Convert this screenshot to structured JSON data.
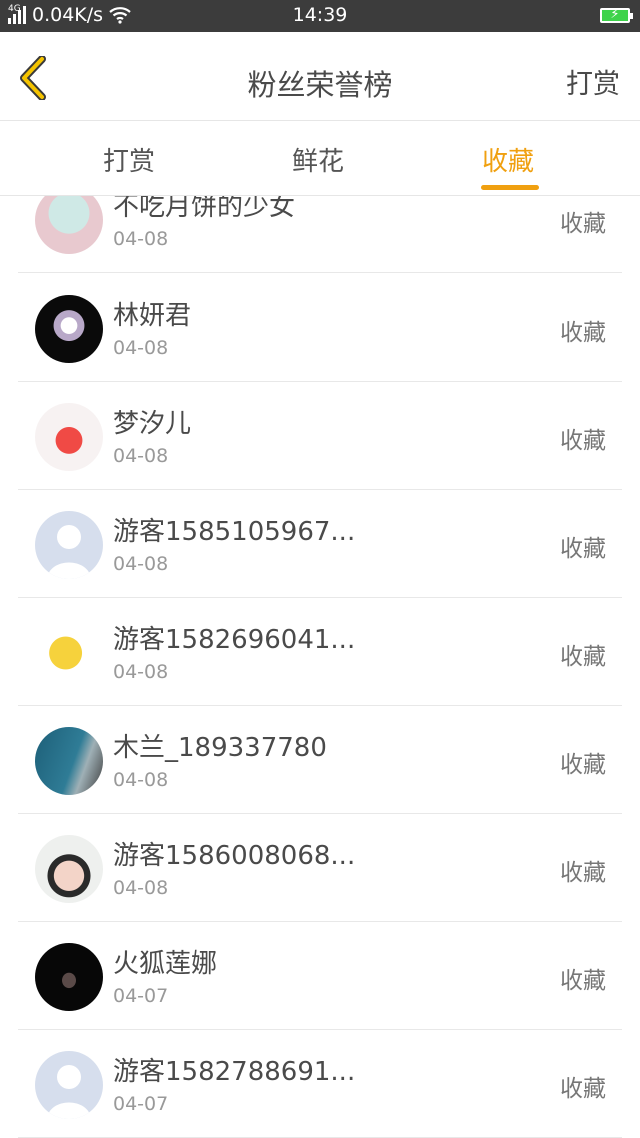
{
  "status_bar": {
    "network_type": "4G",
    "speed": "0.04K/s",
    "time": "14:39",
    "battery_color": "#3fd34b"
  },
  "header": {
    "title": "粉丝荣誉榜",
    "right_action": "打赏"
  },
  "tabs": [
    {
      "label": "打赏",
      "active": false
    },
    {
      "label": "鲜花",
      "active": false
    },
    {
      "label": "收藏",
      "active": true
    }
  ],
  "accent_color": "#f0a010",
  "list": [
    {
      "name": "不吃月饼的少女",
      "date": "04-08",
      "action": "收藏",
      "avatar": "cartoon-girl"
    },
    {
      "name": "林妍君",
      "date": "04-08",
      "action": "收藏",
      "avatar": "white-fox-dark"
    },
    {
      "name": "梦汐儿",
      "date": "04-08",
      "action": "收藏",
      "avatar": "red-bird"
    },
    {
      "name": "游客1585105967...",
      "date": "04-08",
      "action": "收藏",
      "avatar": "default-user"
    },
    {
      "name": "游客1582696041...",
      "date": "04-08",
      "action": "收藏",
      "avatar": "pikachu"
    },
    {
      "name": "木兰_189337780",
      "date": "04-08",
      "action": "收藏",
      "avatar": "blue-water"
    },
    {
      "name": "游客1586008068...",
      "date": "04-08",
      "action": "收藏",
      "avatar": "bunny-ears-girl"
    },
    {
      "name": "火狐莲娜",
      "date": "04-07",
      "action": "收藏",
      "avatar": "dark-figure"
    },
    {
      "name": "游客1582788691...",
      "date": "04-07",
      "action": "收藏",
      "avatar": "default-user"
    }
  ]
}
